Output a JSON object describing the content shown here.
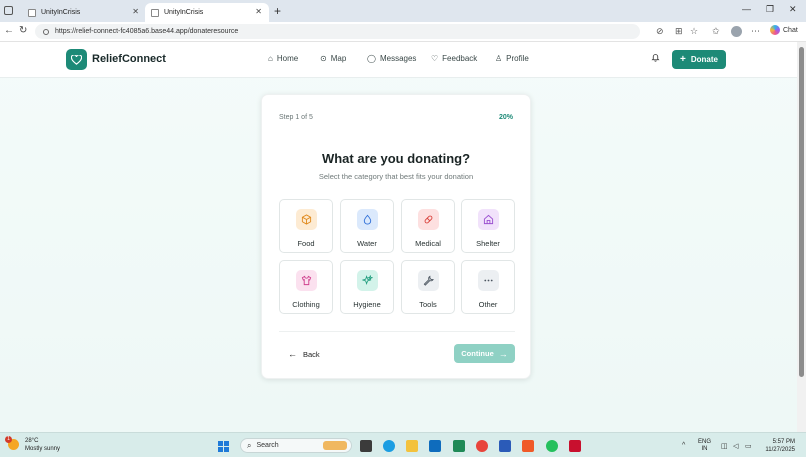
{
  "browser": {
    "tabs": [
      {
        "label": "UnityInCrisis",
        "active": false
      },
      {
        "label": "UnityInCrisis",
        "active": true
      }
    ],
    "url": "https://relief-connect-fc4085a6.base44.app/donateresource",
    "chat_label": "Chat",
    "window_controls": [
      "—",
      "❐",
      "✕"
    ]
  },
  "app": {
    "brand": "ReliefConnect",
    "brand_color": "#1d8a77",
    "nav": [
      {
        "label": "Home",
        "icon": "home-icon"
      },
      {
        "label": "Map",
        "icon": "map-pin-icon"
      },
      {
        "label": "Messages",
        "icon": "message-icon"
      },
      {
        "label": "Feedback",
        "icon": "heart-icon"
      },
      {
        "label": "Profile",
        "icon": "user-icon"
      }
    ],
    "donate_label": "Donate"
  },
  "wizard": {
    "step_label": "Step 1 of 5",
    "progress_label": "20%",
    "progress_fraction": 0.2,
    "title": "What are you donating?",
    "subtitle": "Select the category that best fits your donation",
    "categories": [
      {
        "label": "Food",
        "icon": "box-icon",
        "bg": "#fdebd3",
        "fg": "#e08a1e"
      },
      {
        "label": "Water",
        "icon": "droplet-icon",
        "bg": "#dbe9fc",
        "fg": "#2f6fd8"
      },
      {
        "label": "Medical",
        "icon": "pill-icon",
        "bg": "#fde0e0",
        "fg": "#d9413b"
      },
      {
        "label": "Shelter",
        "icon": "house-icon",
        "bg": "#f1e2fb",
        "fg": "#9a4fd0"
      },
      {
        "label": "Clothing",
        "icon": "shirt-icon",
        "bg": "#fbe1ef",
        "fg": "#cf3f8d"
      },
      {
        "label": "Hygiene",
        "icon": "sparkle-icon",
        "bg": "#d3f3ea",
        "fg": "#1e9c7c"
      },
      {
        "label": "Tools",
        "icon": "wrench-icon",
        "bg": "#eceff2",
        "fg": "#4b5560"
      },
      {
        "label": "Other",
        "icon": "ellipsis-icon",
        "bg": "#eceff2",
        "fg": "#4b5560"
      }
    ],
    "back_label": "Back",
    "continue_label": "Continue"
  },
  "taskbar": {
    "weather_temp": "28°C",
    "weather_desc": "Mostly sunny",
    "weather_badge": "1",
    "search_label": "Search",
    "lang_line1": "ENG",
    "lang_line2": "IN",
    "time": "5:57 PM",
    "date": "11/27/2025"
  }
}
